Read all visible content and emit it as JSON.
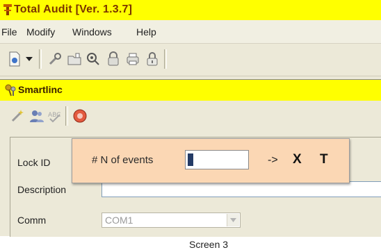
{
  "app": {
    "title": "Total Audit  [Ver. 1.3.7]",
    "accent_color": "#ffff00",
    "logo_icon": "total-audit-logo-icon"
  },
  "menu": {
    "items": [
      "File",
      "Modify",
      "Windows",
      "Help"
    ]
  },
  "toolbar": {
    "icons": [
      "new-document-icon",
      "dropdown-arrow-icon",
      "wrench-tool-icon",
      "folder-open-icon",
      "key-ring-icon",
      "lock-icon",
      "printer-icon",
      "padlock-icon"
    ]
  },
  "child_window": {
    "title": "Smartlinc",
    "icon": "keys-icon",
    "toolbar_icons": [
      "magic-wand-icon",
      "users-icon",
      "spellcheck-icon",
      "record-icon"
    ]
  },
  "form": {
    "lock_id_label": "Lock ID",
    "description_label": "Description",
    "description_value": "",
    "comm_label": "Comm",
    "comm_value": "COM1"
  },
  "popup": {
    "background": "#fbd7b4",
    "label": "# N of events",
    "input_value": "",
    "arrow_label": "->",
    "x_label": "X",
    "t_label": "T"
  },
  "caption": "Screen 3"
}
